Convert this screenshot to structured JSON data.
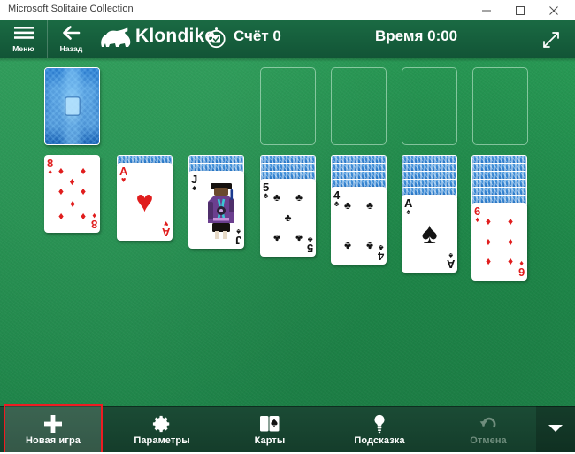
{
  "window": {
    "title": "Microsoft Solitaire Collection",
    "controls": [
      {
        "name": "minimize",
        "glyph": "minimize-icon"
      },
      {
        "name": "maximize",
        "glyph": "maximize-icon"
      },
      {
        "name": "close",
        "glyph": "close-icon"
      }
    ]
  },
  "header": {
    "menu_label": "Меню",
    "back_label": "Назад",
    "logo_icon": "polar-bear-icon",
    "game_title": "Klondike",
    "score_icon": "score-badge-icon",
    "score_label": "Счёт",
    "score_value": "0",
    "score_text": "Счёт 0",
    "time_label": "Время",
    "time_value": "0:00",
    "time_text": "Время 0:00",
    "expand_icon": "expand-diagonal-icon",
    "bar_color": "#14603c"
  },
  "table": {
    "felt_color": "#22924f",
    "stock": {
      "label": "stock-pile",
      "face_down": true,
      "cards_remaining": 24
    },
    "waste": {
      "label": "waste-pile",
      "empty": true
    },
    "foundations": [
      {
        "slot": 1,
        "empty": true
      },
      {
        "slot": 2,
        "empty": true
      },
      {
        "slot": 3,
        "empty": true
      },
      {
        "slot": 4,
        "empty": true
      }
    ],
    "tableau": [
      {
        "column": 1,
        "face_down": 0,
        "rank": "8",
        "suit": "♦",
        "color": "red",
        "pips": 8
      },
      {
        "column": 2,
        "face_down": 1,
        "rank": "A",
        "suit": "♥",
        "color": "red",
        "pips": 1
      },
      {
        "column": 3,
        "face_down": 2,
        "rank": "J",
        "suit": "♠",
        "color": "black",
        "pips": 0
      },
      {
        "column": 4,
        "face_down": 3,
        "rank": "5",
        "suit": "♣",
        "color": "black",
        "pips": 5
      },
      {
        "column": 5,
        "face_down": 4,
        "rank": "4",
        "suit": "♣",
        "color": "black",
        "pips": 4
      },
      {
        "column": 6,
        "face_down": 5,
        "rank": "A",
        "suit": "♠",
        "color": "black",
        "pips": 1
      },
      {
        "column": 7,
        "face_down": 6,
        "rank": "6",
        "suit": "♦",
        "color": "red",
        "pips": 6
      }
    ]
  },
  "toolbar": {
    "items": [
      {
        "id": "new-game",
        "label": "Новая игра",
        "icon": "plus-icon",
        "enabled": true,
        "highlighted": true
      },
      {
        "id": "options",
        "label": "Параметры",
        "icon": "gear-icon",
        "enabled": true,
        "highlighted": false
      },
      {
        "id": "cards",
        "label": "Карты",
        "icon": "cards-icon",
        "enabled": true,
        "highlighted": false
      },
      {
        "id": "hint",
        "label": "Подсказка",
        "icon": "lightbulb-icon",
        "enabled": true,
        "highlighted": false
      },
      {
        "id": "undo",
        "label": "Отмена",
        "icon": "undo-icon",
        "enabled": false,
        "highlighted": false
      }
    ],
    "expander_icon": "chevron-down-icon",
    "annotation_color": "#ee1c22"
  }
}
